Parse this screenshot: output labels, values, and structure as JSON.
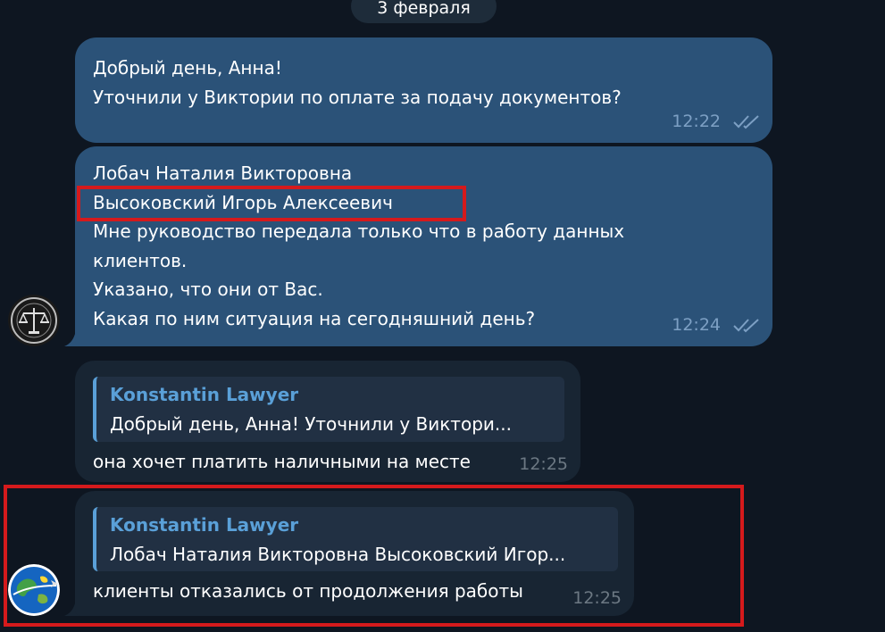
{
  "date_separator": "3 февраля",
  "messages": [
    {
      "lines": [
        "Добрый день, Анна!",
        "Уточнили у Виктории по оплате за подачу документов?"
      ],
      "time": "12:22"
    },
    {
      "lines": [
        "Лобач Наталия Викторовна",
        "Высоковский Игорь Алексеевич",
        "Мне руководство передала только что в работу данных",
        "клиентов.",
        "Указано, что они от Вас.",
        "Какая по ним ситуация на сегодняшний день?"
      ],
      "time": "12:24"
    },
    {
      "reply_author": "Konstantin Lawyer",
      "reply_text": "Добрый день, Анна!  Уточнили у Виктори...",
      "text": "она хочет платить наличными на месте",
      "time": "12:25"
    },
    {
      "reply_author": "Konstantin Lawyer",
      "reply_text": "Лобач Наталия Викторовна Высоковский Игор...",
      "text": "клиенты отказались от продолжения работы",
      "time": "12:25"
    }
  ],
  "icons": {
    "read_status": "double-check-icon",
    "avatar_sender": "scales-of-justice-avatar",
    "avatar_lawyer": "globe-airplane-avatar"
  },
  "colors": {
    "background": "#0e1621",
    "outgoing_bubble": "#2b5278",
    "incoming_bubble": "#182533",
    "reply_accent": "#5aa0d8",
    "highlight": "#d51a1c"
  }
}
